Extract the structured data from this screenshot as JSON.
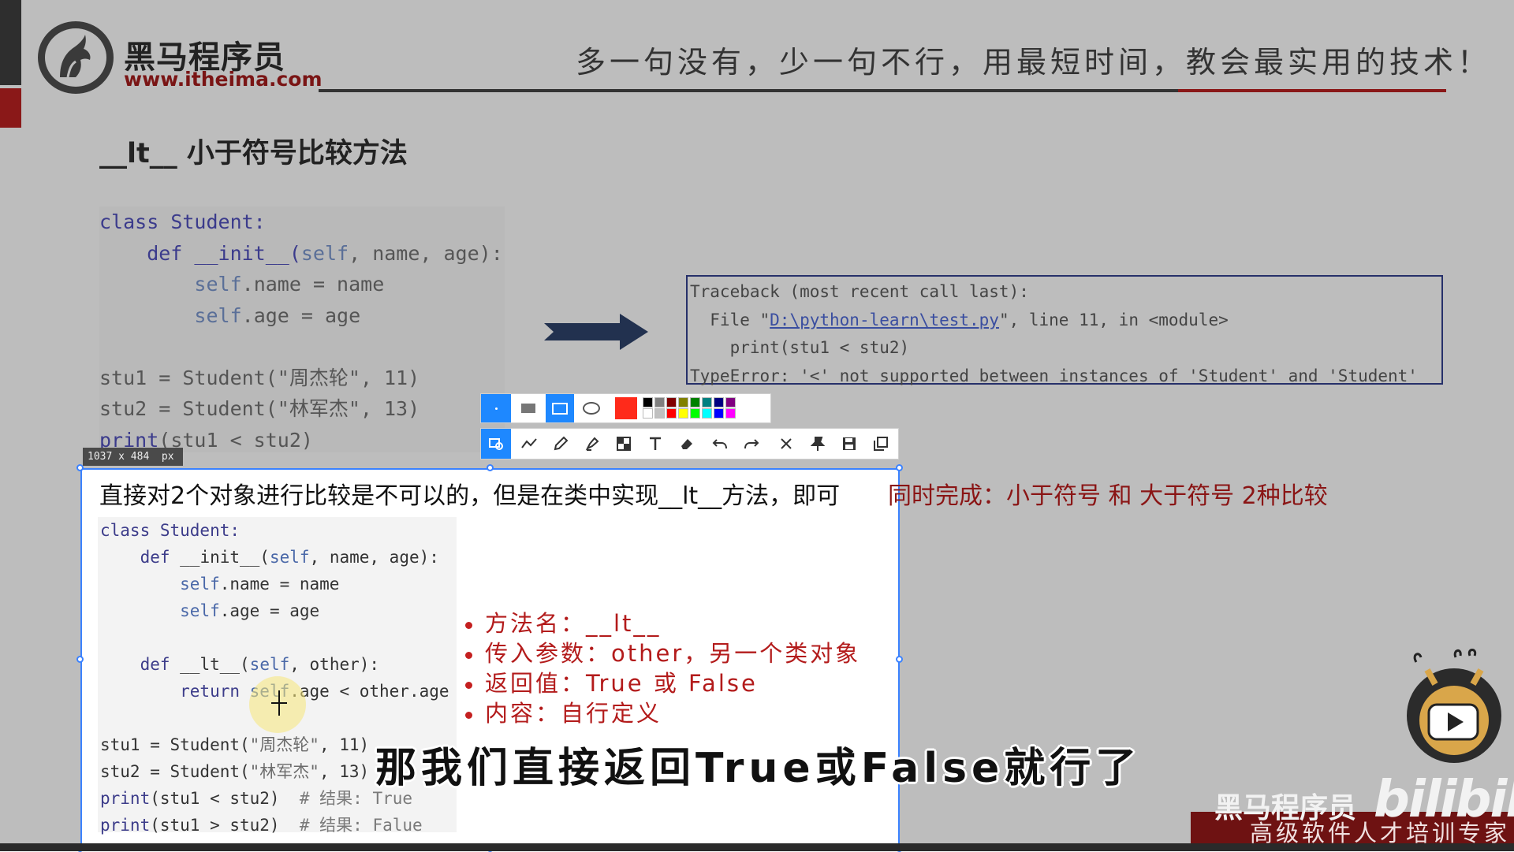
{
  "header": {
    "brand_cn": "黑马程序员",
    "brand_url": "www.itheima.com",
    "slogan": "多一句没有，少一句不行，用最短时间，教会最实用的技术！"
  },
  "slide_title": "__lt__ 小于符号比较方法",
  "code_top": {
    "lines": [
      [
        "class",
        " Student:"
      ],
      [
        "    def",
        " __init__(",
        "self",
        ", name, age):"
      ],
      [
        "        ",
        "self",
        ".name = name"
      ],
      [
        "        ",
        "self",
        ".age = age"
      ],
      [
        ""
      ],
      [
        "stu1 = Student(\"周杰轮\", 11)"
      ],
      [
        "stu2 = Student(\"林军杰\", 13)"
      ],
      [
        "print",
        "(stu1 < stu2)"
      ]
    ]
  },
  "traceback": {
    "line1": "Traceback (most recent call last):",
    "line2_pre": "  File \"",
    "line2_link": "D:\\python-learn\\test.py",
    "line2_post": "\", line 11, in <module>",
    "line3": "    print(stu1 < stu2)",
    "line4": "TypeError: '<' not supported between instances of 'Student' and 'Student'"
  },
  "screenshot_tool": {
    "size_label": "1037 x 484  px",
    "palette": [
      "#000000",
      "#808080",
      "#800000",
      "#808000",
      "#008000",
      "#008080",
      "#000080",
      "#800080",
      "#ffffff",
      "#c0c0c0",
      "#ff0000",
      "#ffff00",
      "#00ff00",
      "#00ffff",
      "#0000ff",
      "#ff00ff"
    ],
    "active_color": "#ff2a1a"
  },
  "desc": {
    "black": "直接对2个对象进行比较是不可以的，但是在类中实现__lt__方法，即可",
    "red": "同时完成：小于符号 和 大于符号 2种比较"
  },
  "code_bottom": {
    "l1a": "class",
    "l1b": " Student:",
    "l2a": "    def",
    "l2b": " __init__(",
    "l2c": "self",
    "l2d": ", name, age):",
    "l3a": "        ",
    "l3b": "self",
    "l3c": ".name = name",
    "l4a": "        ",
    "l4b": "self",
    "l4c": ".age = age",
    "l6a": "    def",
    "l6b": " __lt__(",
    "l6c": "self",
    "l6d": ", other):",
    "l7a": "        return ",
    "l7b": "self",
    "l7c": ".age < other.age",
    "l9a": "stu1 = Student(",
    "l9b": "\"周杰轮\"",
    "l9c": ", 11)",
    "l10a": "stu2 = Student(",
    "l10b": "\"林军杰\"",
    "l10c": ", 13)",
    "l11a": "print",
    "l11b": "(stu1 < stu2)  ",
    "l11c": "# 结果: True",
    "l12a": "print",
    "l12b": "(stu1 > stu2)  ",
    "l12c": "# 结果: Falue"
  },
  "bullets": [
    "方法名：__lt__",
    "传入参数：other，另一个类对象",
    "返回值：True 或 False",
    "内容：自行定义"
  ],
  "subtitle": "那我们直接返回True或False就行了",
  "watermark": {
    "brand_cn": "黑马程序员",
    "bili": "bilibili",
    "sub": "高级软件人才培训专家"
  }
}
